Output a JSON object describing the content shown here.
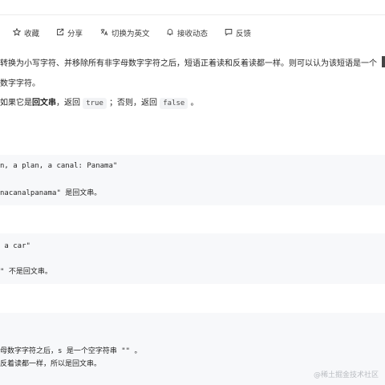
{
  "toolbar": {
    "favorite": "收藏",
    "share": "分享",
    "switch_language": "切换为英文",
    "subscribe": "接收动态",
    "feedback": "反馈"
  },
  "description": {
    "line1": "转换为小写字符、并移除所有非字母数字字符之后，短语正着读和反着读都一样。则可以认为该短语是一个",
    "line2": "数字字符。",
    "line3_prefix": "如果它是",
    "line3_bold": "回文串",
    "line3_mid1": "，返回",
    "line3_true": "true",
    "line3_mid2": "；否则，返回",
    "line3_false": "false",
    "line3_end": "。"
  },
  "examples": [
    {
      "input": "n, a plan, a canal: Panama\"",
      "explain": "nacanalpanama\" 是回文串。"
    },
    {
      "input": " a car\"",
      "explain": "\" 不是回文串。"
    },
    {
      "explain1": "母数字字符之后，s 是一个空字符串 \"\" 。",
      "explain2": "反着读都一样，所以是回文串。"
    }
  ],
  "watermark": "@稀土掘金技术社区"
}
